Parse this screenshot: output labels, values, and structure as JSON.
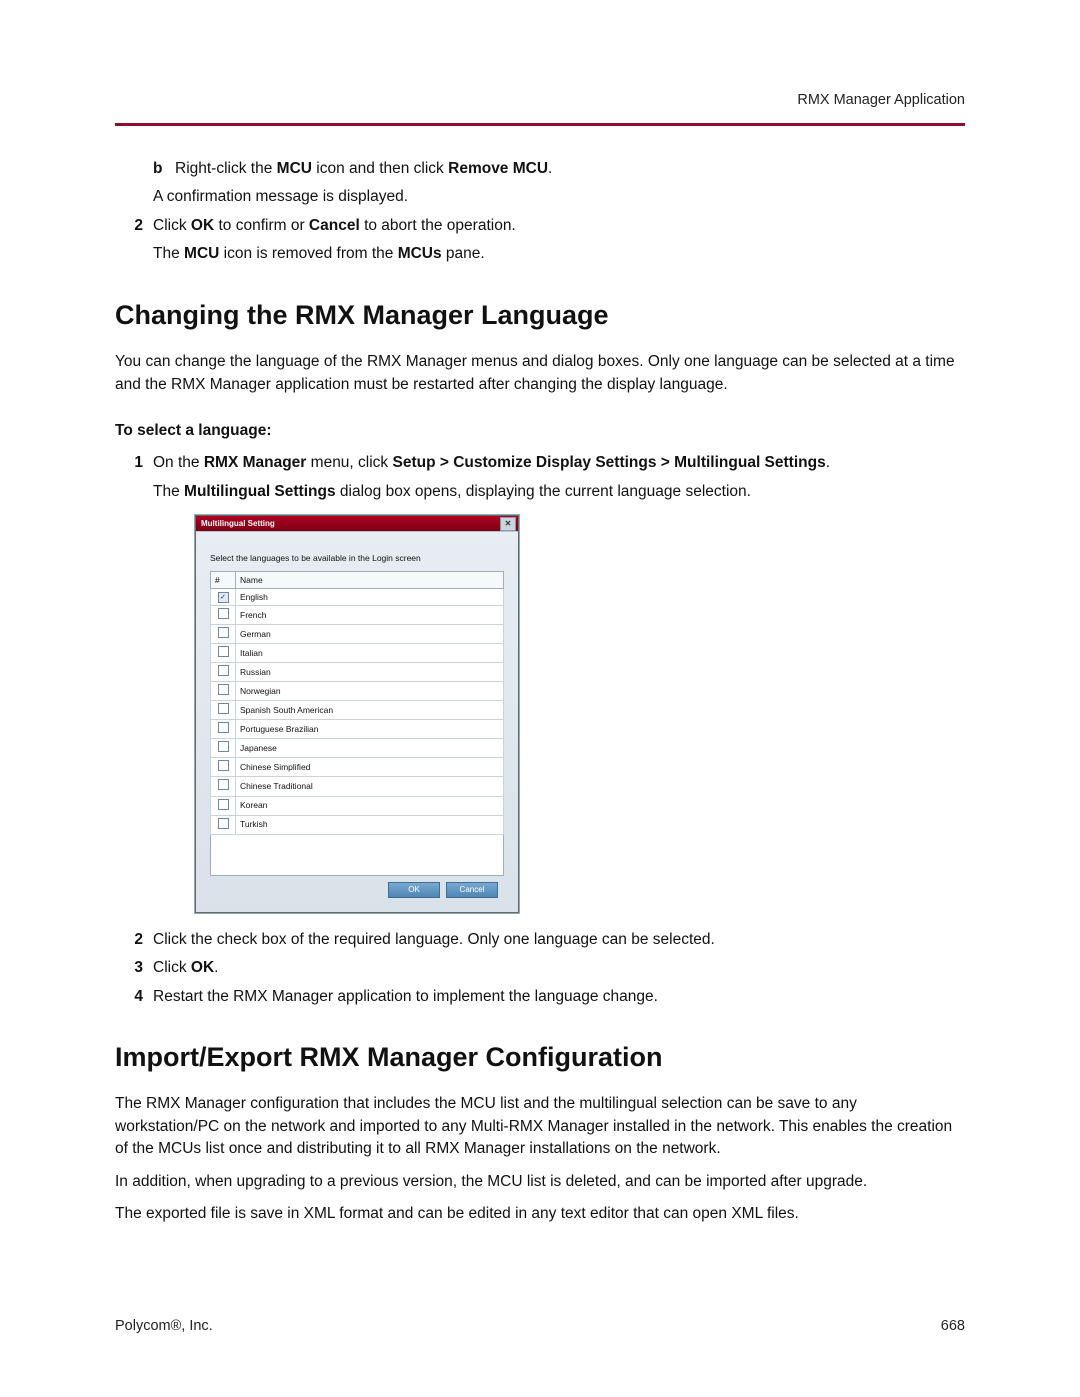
{
  "header": {
    "section": "RMX Manager Application"
  },
  "pre": {
    "b": {
      "marker": "b",
      "t1": "Right-click the",
      "t2": "MCU",
      "t3": "icon and then click",
      "t4": "Remove MCU",
      "t5": ".",
      "note": "A confirmation message is displayed."
    },
    "s2": {
      "marker": "2",
      "t1": "Click",
      "t2": "OK",
      "t3": "to confirm or",
      "t4": "Cancel",
      "t5": "to abort the operation.",
      "n1": "The",
      "n2": "MCU",
      "n3": "icon is removed from the",
      "n4": "MCUs",
      "n5": "pane."
    }
  },
  "sec1": {
    "heading": "Changing the RMX Manager Language",
    "lead": "You can change the language of the RMX Manager menus and dialog boxes. Only one language can be selected at a time and the RMX Manager application must be restarted after changing the display language.",
    "subhead": "To select a language:",
    "s1": {
      "marker": "1",
      "t1": "On the",
      "t2": "RMX Manager",
      "t3": "menu, click",
      "t4": "Setup > Customize Display Settings > Multilingual Settings",
      "t5": ".",
      "n1": "The",
      "n2": "Multilingual Settings",
      "n3": "dialog box opens, displaying the current language selection."
    },
    "s2": {
      "marker": "2",
      "text": "Click the check box of the required language. Only one language can be selected."
    },
    "s3": {
      "marker": "3",
      "t1": "Click",
      "t2": "OK",
      "t3": "."
    },
    "s4": {
      "marker": "4",
      "text": "Restart the RMX Manager application to implement the language change."
    }
  },
  "dialog": {
    "title": "Multilingual Setting",
    "caption": "Select the languages to be available in the Login screen",
    "cols": {
      "check": "#",
      "name": "Name"
    },
    "languages": [
      {
        "checked": true,
        "name": "English"
      },
      {
        "checked": false,
        "name": "French"
      },
      {
        "checked": false,
        "name": "German"
      },
      {
        "checked": false,
        "name": "Italian"
      },
      {
        "checked": false,
        "name": "Russian"
      },
      {
        "checked": false,
        "name": "Norwegian"
      },
      {
        "checked": false,
        "name": "Spanish South American"
      },
      {
        "checked": false,
        "name": "Portuguese Brazilian"
      },
      {
        "checked": false,
        "name": "Japanese"
      },
      {
        "checked": false,
        "name": "Chinese Simplified"
      },
      {
        "checked": false,
        "name": "Chinese Traditional"
      },
      {
        "checked": false,
        "name": "Korean"
      },
      {
        "checked": false,
        "name": "Turkish"
      }
    ],
    "ok": "OK",
    "cancel": "Cancel"
  },
  "sec2": {
    "heading": "Import/Export RMX Manager Configuration",
    "p1": "The RMX Manager configuration that includes the MCU list and the multilingual selection can be save to any workstation/PC on the network and imported to any Multi-RMX Manager installed in the network. This enables the creation of the MCUs list once and distributing it to all RMX Manager installations on the network.",
    "p2": "In addition, when upgrading to a previous version, the MCU list is deleted, and can be imported after upgrade.",
    "p3": "The exported file is save in XML format and can be edited in any text editor that can open XML files."
  },
  "footer": {
    "company": "Polycom®, Inc.",
    "page": "668"
  }
}
